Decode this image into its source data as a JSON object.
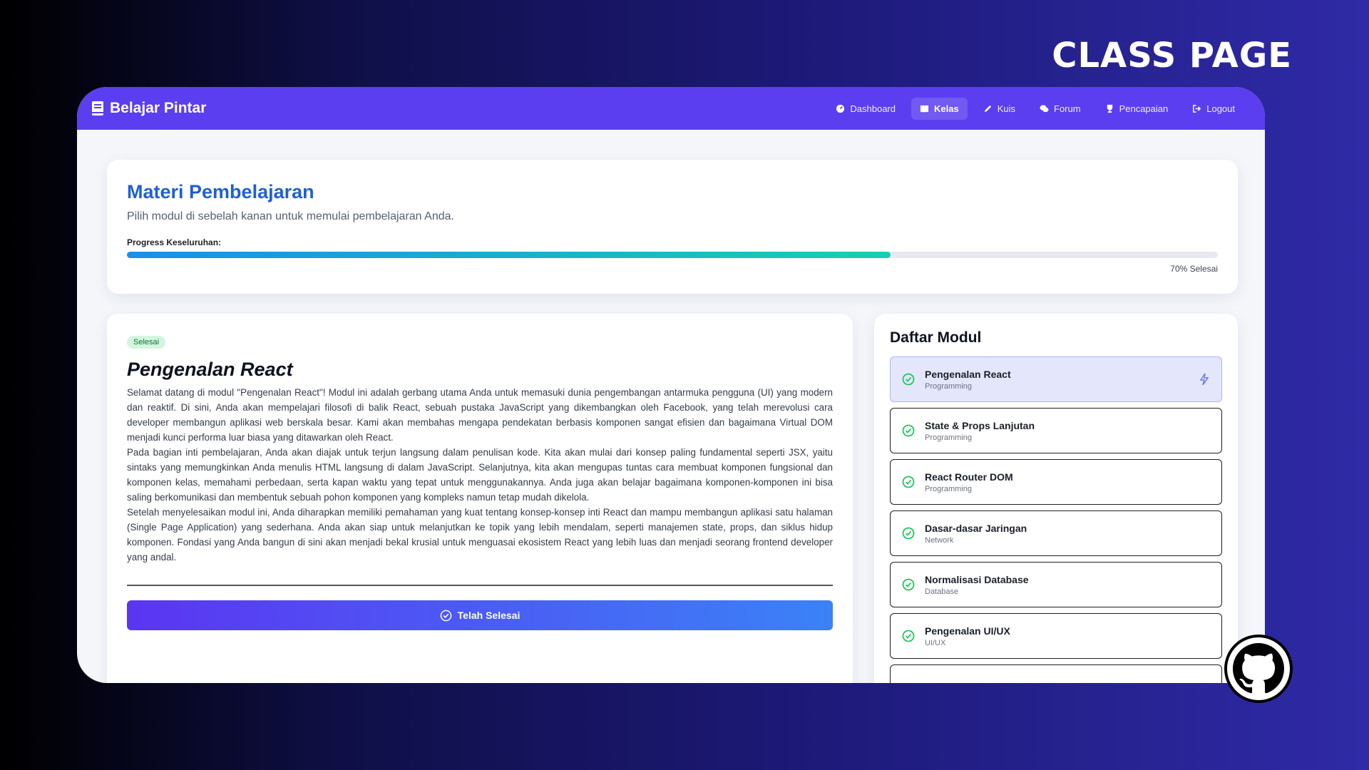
{
  "hero": {
    "title": "CLASS PAGE"
  },
  "navbar": {
    "brand": "Belajar Pintar",
    "links": [
      {
        "label": "Dashboard",
        "icon": "dashboard-icon"
      },
      {
        "label": "Kelas",
        "icon": "book-icon",
        "active": true
      },
      {
        "label": "Kuis",
        "icon": "pencil-icon"
      },
      {
        "label": "Forum",
        "icon": "chat-icon"
      },
      {
        "label": "Pencapaian",
        "icon": "trophy-icon"
      },
      {
        "label": "Logout",
        "icon": "logout-icon"
      }
    ]
  },
  "overview": {
    "title": "Materi Pembelajaran",
    "subtitle": "Pilih modul di sebelah kanan untuk memulai pembelajaran Anda.",
    "progress_label": "Progress Keseluruhan:",
    "progress_percent": 70,
    "progress_caption": "70% Selesai"
  },
  "lesson": {
    "badge": "Selesai",
    "title": "Pengenalan React",
    "paragraphs": [
      "Selamat datang di modul \"Pengenalan React\"! Modul ini adalah gerbang utama Anda untuk memasuki dunia pengembangan antarmuka pengguna (UI) yang modern dan reaktif. Di sini, Anda akan mempelajari filosofi di balik React, sebuah pustaka JavaScript yang dikembangkan oleh Facebook, yang telah merevolusi cara developer membangun aplikasi web berskala besar. Kami akan membahas mengapa pendekatan berbasis komponen sangat efisien dan bagaimana Virtual DOM menjadi kunci performa luar biasa yang ditawarkan oleh React.",
      "Pada bagian inti pembelajaran, Anda akan diajak untuk terjun langsung dalam penulisan kode. Kita akan mulai dari konsep paling fundamental seperti JSX, yaitu sintaks yang memungkinkan Anda menulis HTML langsung di dalam JavaScript. Selanjutnya, kita akan mengupas tuntas cara membuat komponen fungsional dan komponen kelas, memahami perbedaan, serta kapan waktu yang tepat untuk menggunakannya. Anda juga akan belajar bagaimana komponen-komponen ini bisa saling berkomunikasi dan membentuk sebuah pohon komponen yang kompleks namun tetap mudah dikelola.",
      "Setelah menyelesaikan modul ini, Anda diharapkan memiliki pemahaman yang kuat tentang konsep-konsep inti React dan mampu membangun aplikasi satu halaman (Single Page Application) yang sederhana. Anda akan siap untuk melanjutkan ke topik yang lebih mendalam, seperti manajemen state, props, dan siklus hidup komponen. Fondasi yang Anda bangun di sini akan menjadi bekal krusial untuk menguasai ekosistem React yang lebih luas dan menjadi seorang frontend developer yang andal."
    ],
    "button_label": "Telah Selesai"
  },
  "modules": {
    "title": "Daftar Modul",
    "items": [
      {
        "name": "Pengenalan React",
        "category": "Programming"
      },
      {
        "name": "State & Props Lanjutan",
        "category": "Programming"
      },
      {
        "name": "React Router DOM",
        "category": "Programming"
      },
      {
        "name": "Dasar-dasar Jaringan",
        "category": "Network"
      },
      {
        "name": "Normalisasi Database",
        "category": "Database"
      },
      {
        "name": "Pengenalan UI/UX",
        "category": "UI/UX"
      }
    ]
  },
  "colors": {
    "navbar": "#5a3ef0",
    "accent_title": "#1f5fd6",
    "check_green": "#22c55e"
  }
}
